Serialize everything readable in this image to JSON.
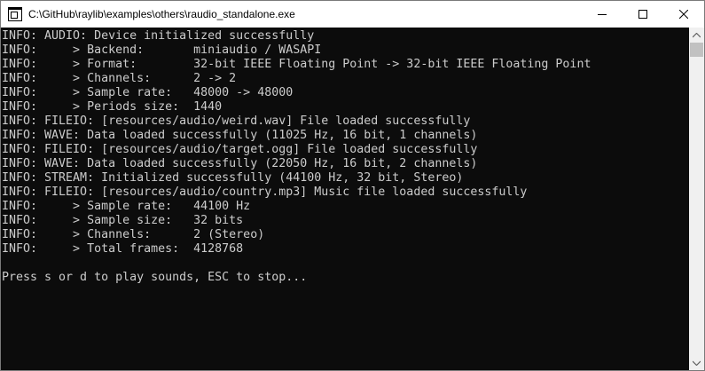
{
  "window": {
    "title": "C:\\GitHub\\raylib\\examples\\others\\raudio_standalone.exe"
  },
  "titlebar": {
    "icons": {
      "app": "console-app-icon",
      "minimize": "minimize-icon",
      "maximize": "maximize-icon",
      "close": "close-icon"
    }
  },
  "console": {
    "lines": [
      "INFO: AUDIO: Device initialized successfully",
      "INFO:     > Backend:       miniaudio / WASAPI",
      "INFO:     > Format:        32-bit IEEE Floating Point -> 32-bit IEEE Floating Point",
      "INFO:     > Channels:      2 -> 2",
      "INFO:     > Sample rate:   48000 -> 48000",
      "INFO:     > Periods size:  1440",
      "INFO: FILEIO: [resources/audio/weird.wav] File loaded successfully",
      "INFO: WAVE: Data loaded successfully (11025 Hz, 16 bit, 1 channels)",
      "INFO: FILEIO: [resources/audio/target.ogg] File loaded successfully",
      "INFO: WAVE: Data loaded successfully (22050 Hz, 16 bit, 2 channels)",
      "INFO: STREAM: Initialized successfully (44100 Hz, 32 bit, Stereo)",
      "INFO: FILEIO: [resources/audio/country.mp3] Music file loaded successfully",
      "INFO:     > Sample rate:   44100 Hz",
      "INFO:     > Sample size:   32 bits",
      "INFO:     > Channels:      2 (Stereo)",
      "INFO:     > Total frames:  4128768",
      "",
      "Press s or d to play sounds, ESC to stop..."
    ],
    "colors": {
      "background": "#0c0c0c",
      "text": "#cccccc"
    }
  },
  "scrollbar": {
    "position_fraction": 0.0
  }
}
